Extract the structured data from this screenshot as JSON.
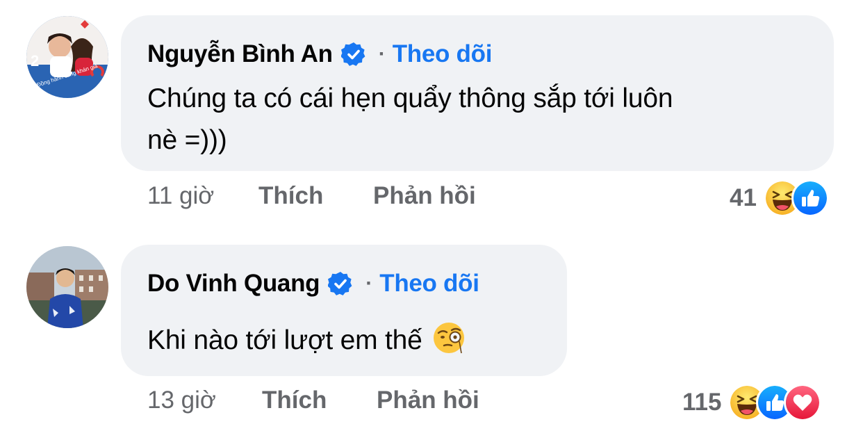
{
  "comments": [
    {
      "author": "Nguyễn Bình An",
      "separator": "·",
      "follow_label": "Theo dõi",
      "text_line1": "Chúng ta có cái hẹn quẩy thông sắp tới luôn",
      "text_line2": "nè =)))",
      "time": "11 giờ",
      "like_label": "Thích",
      "reply_label": "Phản hồi",
      "reaction_count": "41",
      "reactions": [
        "haha-icon",
        "like-icon"
      ]
    },
    {
      "author": "Do Vinh Quang",
      "separator": "·",
      "follow_label": "Theo dõi",
      "text": "Khi nào tới lượt em thế",
      "inline_emoji": "face-with-monocle-icon",
      "time": "13 giờ",
      "like_label": "Thích",
      "reply_label": "Phản hồi",
      "reaction_count": "115",
      "reactions": [
        "haha-icon",
        "like-icon",
        "love-icon"
      ]
    }
  ],
  "colors": {
    "bubble": "#f0f2f5",
    "link": "#1877f2",
    "meta": "#65676b",
    "text": "#050505",
    "verified": "#1877f2",
    "love": "#f33e58",
    "haha": "#f7b125"
  }
}
